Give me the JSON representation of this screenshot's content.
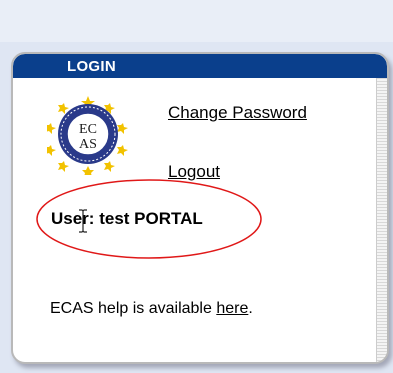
{
  "login": {
    "title": "LOGIN",
    "seal_text": [
      "EC",
      "AS"
    ],
    "change_password": "Change Password",
    "logout": "Logout",
    "user_label": "User:",
    "user_name": "test PORTAL",
    "help_prefix": "ECAS help is available ",
    "help_link": "here",
    "help_suffix": "."
  },
  "colors": {
    "header": "#0a3f8c",
    "annotation": "#e01818",
    "seal_blue": "#2a3a8a",
    "seal_stars": "#f2c200"
  }
}
